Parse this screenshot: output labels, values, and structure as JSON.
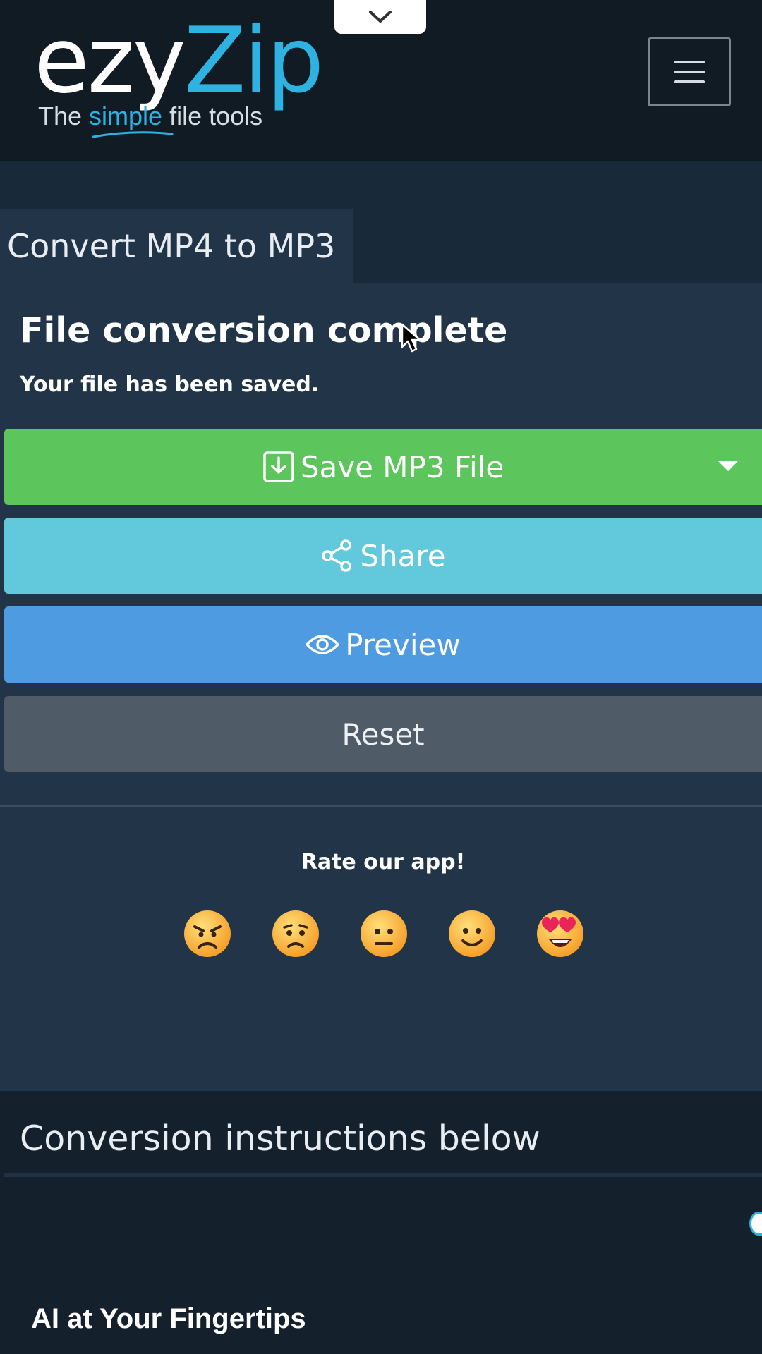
{
  "header": {
    "logo_part1": "ezy",
    "logo_part2": "Zip",
    "tagline_before": "The ",
    "tagline_highlight": "simple",
    "tagline_after": " file tools",
    "menu_icon": "hamburger-menu-icon",
    "pull_tab_icon": "chevron-down-icon"
  },
  "tab": {
    "label": "Convert MP4 to MP3"
  },
  "result": {
    "title": "File conversion complete",
    "subtitle": "Your file has been saved."
  },
  "actions": {
    "save_label": "Save MP3 File",
    "share_label": "Share",
    "preview_label": "Preview",
    "reset_label": "Reset"
  },
  "rating": {
    "label": "Rate our app!",
    "emojis": [
      "angry-face-icon",
      "sad-face-icon",
      "neutral-face-icon",
      "smiling-face-icon",
      "heart-eyes-face-icon"
    ]
  },
  "instructions": {
    "heading": "Conversion instructions below"
  },
  "ad": {
    "title": "AI at Your Fingertips"
  },
  "colors": {
    "brand_blue": "#2eb2e2",
    "save_green": "#5cc55c",
    "share_cyan": "#62c8dc",
    "preview_blue": "#4f9be2",
    "reset_gray": "#4f5b67"
  }
}
